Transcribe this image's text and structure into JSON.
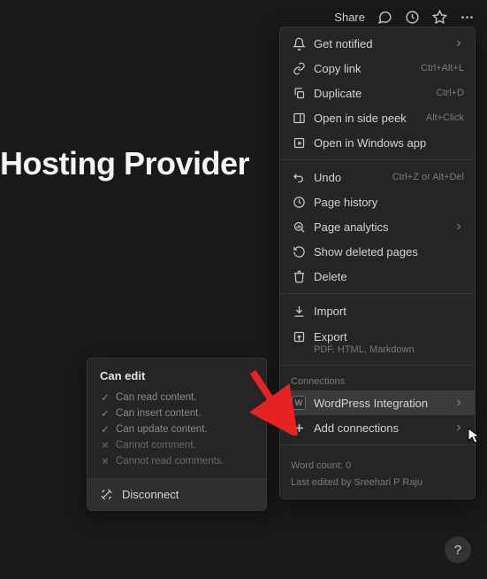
{
  "topbar": {
    "share": "Share"
  },
  "page": {
    "title": "Hosting Provider"
  },
  "menu": {
    "get_notified": "Get notified",
    "copy_link": "Copy link",
    "copy_link_shortcut": "Ctrl+Alt+L",
    "duplicate": "Duplicate",
    "duplicate_shortcut": "Ctrl+D",
    "open_side_peek": "Open in side peek",
    "open_side_peek_shortcut": "Alt+Click",
    "open_windows_app": "Open in Windows app",
    "undo": "Undo",
    "undo_shortcut": "Ctrl+Z or Alt+Del",
    "page_history": "Page history",
    "page_analytics": "Page analytics",
    "show_deleted_pages": "Show deleted pages",
    "delete": "Delete",
    "import": "Import",
    "export": "Export",
    "export_sub": "PDF, HTML, Markdown",
    "connections_label": "Connections",
    "wordpress_integration": "WordPress Integration",
    "add_connections": "Add connections",
    "word_count": "Word count: 0",
    "last_edited": "Last edited by Sreehari P Raju"
  },
  "popover": {
    "title": "Can edit",
    "perms": [
      {
        "enabled": true,
        "text": "Can read content."
      },
      {
        "enabled": true,
        "text": "Can insert content."
      },
      {
        "enabled": true,
        "text": "Can update content."
      },
      {
        "enabled": false,
        "text": "Cannot comment."
      },
      {
        "enabled": false,
        "text": "Cannot read comments."
      }
    ],
    "disconnect": "Disconnect"
  },
  "help": "?"
}
